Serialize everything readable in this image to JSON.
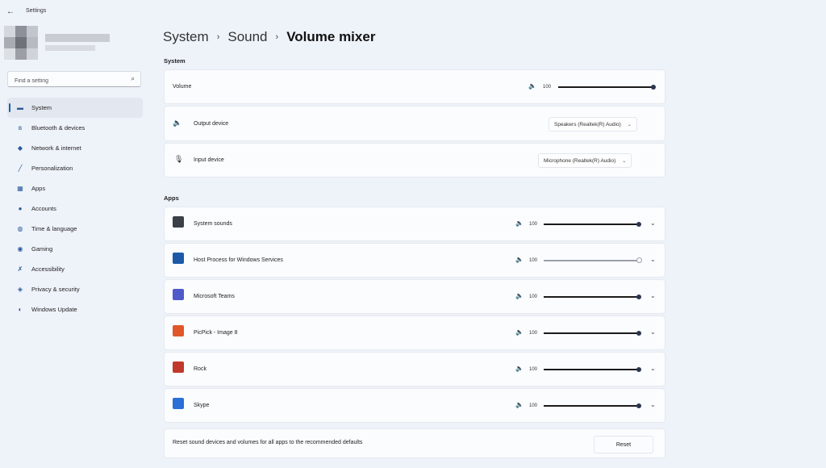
{
  "window": {
    "title": "Settings",
    "back_glyph": "←"
  },
  "search": {
    "placeholder": "Find a setting"
  },
  "nav": {
    "items": [
      {
        "label": "System",
        "icon": "monitor-icon",
        "selected": true
      },
      {
        "label": "Bluetooth & devices",
        "icon": "bluetooth-icon"
      },
      {
        "label": "Network & internet",
        "icon": "wifi-icon"
      },
      {
        "label": "Personalization",
        "icon": "pen-icon"
      },
      {
        "label": "Apps",
        "icon": "apps-icon"
      },
      {
        "label": "Accounts",
        "icon": "person-icon"
      },
      {
        "label": "Time & language",
        "icon": "globe-icon"
      },
      {
        "label": "Gaming",
        "icon": "gamepad-icon"
      },
      {
        "label": "Accessibility",
        "icon": "accessibility-icon"
      },
      {
        "label": "Privacy & security",
        "icon": "shield-icon"
      },
      {
        "label": "Windows Update",
        "icon": "update-icon"
      }
    ]
  },
  "breadcrumb": {
    "part1": "System",
    "part2": "Sound",
    "current": "Volume mixer",
    "separator": "›"
  },
  "system_section": {
    "heading": "System",
    "volume": {
      "label": "Volume",
      "value": "100",
      "level": 1.0
    },
    "output": {
      "label": "Output device",
      "value": "Speakers (Realtek(R) Audio)"
    },
    "input": {
      "label": "Input device",
      "value": "Microphone (Realtek(R) Audio)"
    }
  },
  "apps_section": {
    "heading": "Apps",
    "apps": [
      {
        "name": "System sounds",
        "value": "100",
        "level": 1.0,
        "icon": "speaker-device-icon",
        "color": "#3a3f48"
      },
      {
        "name": "Host Process for Windows Services",
        "value": "100",
        "level": 1.0,
        "muted_style": true,
        "icon": "window-app-icon",
        "color": "#1c5aa8"
      },
      {
        "name": "Microsoft Teams",
        "value": "100",
        "level": 1.0,
        "icon": "teams-icon",
        "color": "#5059c9"
      },
      {
        "name": "PicPick - Image 8",
        "value": "100",
        "level": 1.0,
        "icon": "picpick-icon",
        "color": "#e0572a"
      },
      {
        "name": "Rock",
        "value": "100",
        "level": 1.0,
        "icon": "rock-icon",
        "color": "#c0392b"
      },
      {
        "name": "Skype",
        "value": "100",
        "level": 1.0,
        "icon": "skype-icon",
        "color": "#2a6fd6"
      }
    ]
  },
  "reset": {
    "text": "Reset sound devices and volumes for all apps to the recommended defaults",
    "button": "Reset"
  },
  "colors": {
    "accent": "#1a5fb4",
    "background": "#eef2f9",
    "card": "#fbfcfe"
  }
}
